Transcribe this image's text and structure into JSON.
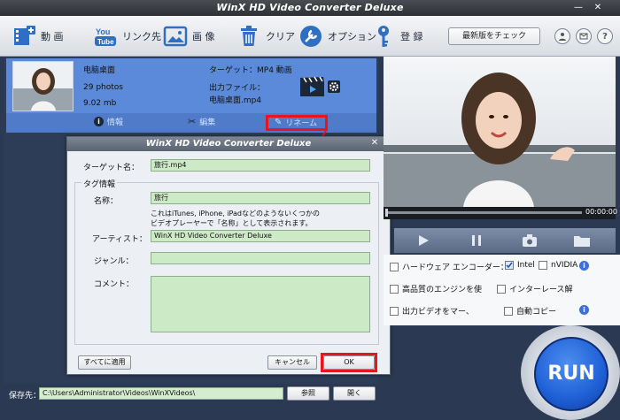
{
  "window": {
    "title": "WinX HD Video Converter Deluxe"
  },
  "toolbar": {
    "video_label": "動 画",
    "youtube_label": "リンク先",
    "photo_label": "画 像",
    "clear_label": "クリア",
    "option_label": "オプション",
    "register_label": "登 録",
    "update_label": "最新版をチェック"
  },
  "file": {
    "name": "电脑桌面",
    "count": "29 photos",
    "size": "9.02 mb",
    "target": "ターゲット：MP4 動画",
    "output_label": "出力ファイル：",
    "output_name": "电脑桌面.mp4"
  },
  "file_actions": {
    "info": "情報",
    "edit": "編集",
    "rename": "リネーム"
  },
  "dialog": {
    "title": "WinX HD Video Converter Deluxe",
    "target_label": "ターゲット名：",
    "target_value": "旅行.mp4",
    "tag_section": "タグ情報",
    "name_label": "名称：",
    "name_value": "旅行",
    "hint_line1": "これはiTunes, iPhone, iPadなどのようないくつかの",
    "hint_line2": "ビデオプレーヤーで「名称」として表示されます。",
    "artist_label": "アーティスト：",
    "artist_value": "WinX HD Video Converter Deluxe",
    "genre_label": "ジャンル：",
    "genre_value": "",
    "comment_label": "コメント：",
    "comment_value": "",
    "apply_all": "すべてに適用",
    "cancel": "キャンセル",
    "ok": "OK"
  },
  "preview": {
    "time": "00:00:00"
  },
  "options": {
    "hw_encoder": "ハードウェア エンコーダー：",
    "intel": "Intel",
    "nvidia": "nVIDIA",
    "hq_engine": "高品質のエンジンを使",
    "deinterlace": "インターレース解",
    "merge": "出力ビデオをマー、",
    "autocopy": "自動コピー"
  },
  "bottom": {
    "save_label": "保存先：",
    "save_path": "C:\\Users\\Administrator\\Videos\\WinXVideos\\",
    "browse": "参照",
    "open": "開く"
  },
  "run_label": "RUN",
  "accent": {
    "highlight": "#e8141e",
    "row": "#5a8ad9",
    "field": "#cdeac7",
    "run": "#1e5fd6"
  }
}
